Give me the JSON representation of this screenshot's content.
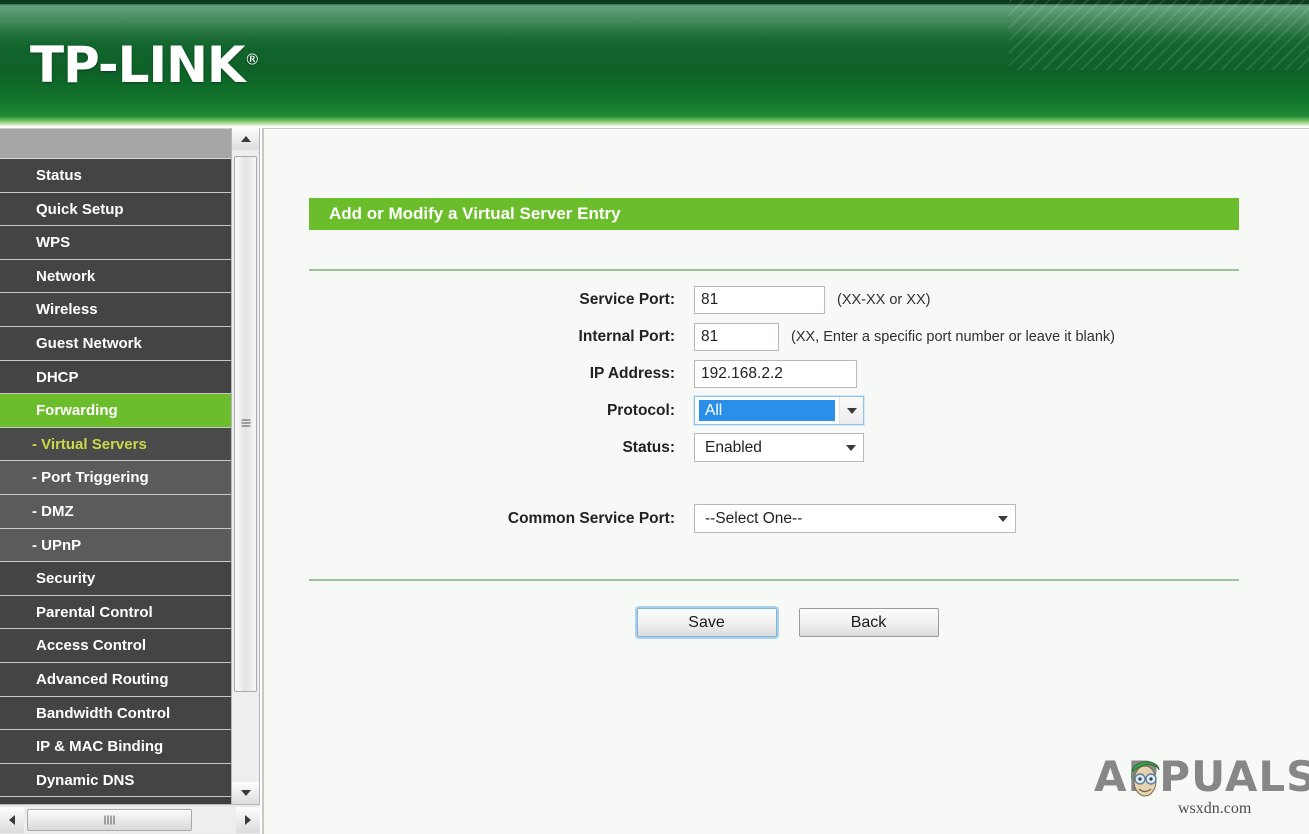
{
  "header": {
    "brand": "TP-LINK",
    "registered_mark": "®"
  },
  "sidebar": {
    "items": [
      {
        "label": "Status",
        "type": "main",
        "state": "normal"
      },
      {
        "label": "Quick Setup",
        "type": "main",
        "state": "normal"
      },
      {
        "label": "WPS",
        "type": "main",
        "state": "normal"
      },
      {
        "label": "Network",
        "type": "main",
        "state": "normal"
      },
      {
        "label": "Wireless",
        "type": "main",
        "state": "normal"
      },
      {
        "label": "Guest Network",
        "type": "main",
        "state": "normal"
      },
      {
        "label": "DHCP",
        "type": "main",
        "state": "normal"
      },
      {
        "label": "Forwarding",
        "type": "main",
        "state": "active"
      },
      {
        "label": "- Virtual Servers",
        "type": "sub",
        "state": "sub-active"
      },
      {
        "label": "- Port Triggering",
        "type": "sub",
        "state": "normal"
      },
      {
        "label": "- DMZ",
        "type": "sub",
        "state": "normal"
      },
      {
        "label": "- UPnP",
        "type": "sub",
        "state": "normal"
      },
      {
        "label": "Security",
        "type": "main",
        "state": "normal"
      },
      {
        "label": "Parental Control",
        "type": "main",
        "state": "normal"
      },
      {
        "label": "Access Control",
        "type": "main",
        "state": "normal"
      },
      {
        "label": "Advanced Routing",
        "type": "main",
        "state": "normal"
      },
      {
        "label": "Bandwidth Control",
        "type": "main",
        "state": "normal"
      },
      {
        "label": "IP & MAC Binding",
        "type": "main",
        "state": "normal"
      },
      {
        "label": "Dynamic DNS",
        "type": "main",
        "state": "normal"
      }
    ]
  },
  "main": {
    "panel_title": "Add or Modify a Virtual Server Entry",
    "fields": {
      "service_port": {
        "label": "Service Port:",
        "value": "81",
        "hint": "(XX-XX or XX)"
      },
      "internal_port": {
        "label": "Internal Port:",
        "value": "81",
        "hint": "(XX, Enter a specific port number or leave it blank)"
      },
      "ip_address": {
        "label": "IP Address:",
        "value": "192.168.2.2",
        "hint": ""
      },
      "protocol": {
        "label": "Protocol:",
        "value": "All"
      },
      "status": {
        "label": "Status:",
        "value": "Enabled"
      },
      "common_service_port": {
        "label": "Common Service Port:",
        "value": "--Select One--"
      }
    },
    "buttons": {
      "save": "Save",
      "back": "Back"
    }
  },
  "watermark": {
    "brand": "APPUALS",
    "site": "wsxdn.com"
  },
  "colors": {
    "brand_green": "#6cbd2b",
    "header_green": "#0d6127",
    "sidebar_dark": "#444444",
    "sidebar_sub": "#5b5b5b",
    "sub_active_text": "#c9d84a",
    "select_highlight": "#2a8fe8",
    "focus_ring": "#a9d2ea"
  }
}
